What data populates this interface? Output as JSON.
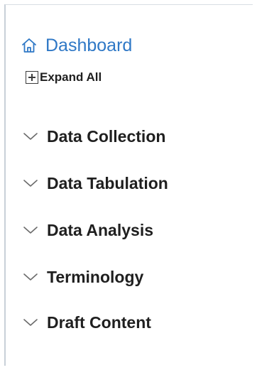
{
  "nav": {
    "dashboard": {
      "label": "Dashboard",
      "icon": "home-icon",
      "color": "#2f78c6"
    },
    "expand_all": {
      "label": "Expand All",
      "icon": "plus-square-icon"
    },
    "sections": [
      {
        "label": "Data Collection",
        "icon": "chevron-down-icon"
      },
      {
        "label": "Data Tabulation",
        "icon": "chevron-down-icon"
      },
      {
        "label": "Data Analysis",
        "icon": "chevron-down-icon"
      },
      {
        "label": "Terminology",
        "icon": "chevron-down-icon"
      },
      {
        "label": "Draft Content",
        "icon": "chevron-down-icon"
      }
    ]
  }
}
